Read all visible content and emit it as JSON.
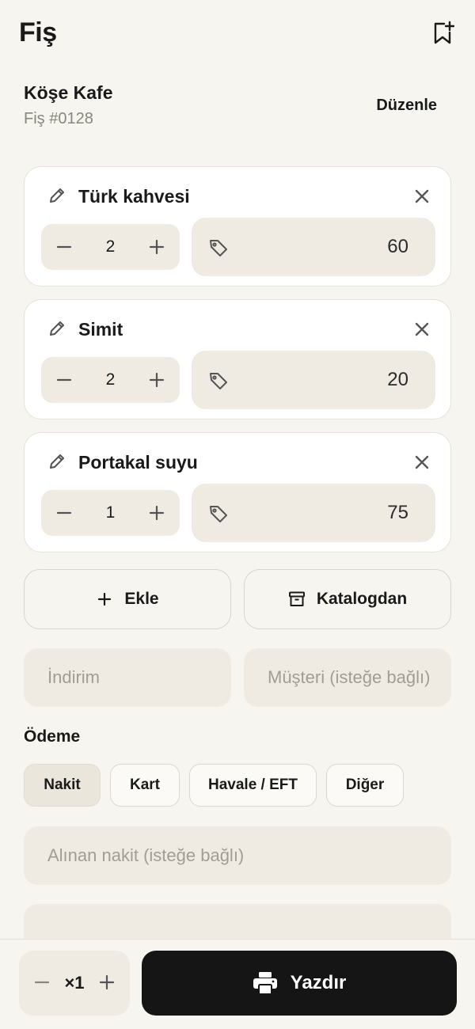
{
  "header": {
    "title": "Fiş",
    "bookmark_icon": "bookmark-add-icon"
  },
  "store": {
    "name": "Köşe Kafe",
    "receipt_number": "Fiş #0128",
    "edit_label": "Düzenle"
  },
  "items": [
    {
      "name": "Türk kahvesi",
      "quantity": "2",
      "price": "60"
    },
    {
      "name": "Simit",
      "quantity": "2",
      "price": "20"
    },
    {
      "name": "Portakal suyu",
      "quantity": "1",
      "price": "75"
    }
  ],
  "actions": {
    "add_label": "Ekle",
    "catalog_label": "Katalogdan"
  },
  "fields": {
    "discount_placeholder": "İndirim",
    "customer_placeholder": "Müşteri (isteğe bağlı)",
    "cash_placeholder": "Alınan nakit (isteğe bağlı)",
    "note_placeholder": ""
  },
  "payment": {
    "label": "Ödeme",
    "methods": [
      "Nakit",
      "Kart",
      "Havale / EFT",
      "Diğer"
    ],
    "selected": "Nakit"
  },
  "footer": {
    "copies": "×1",
    "print_label": "Yazdır"
  },
  "colors": {
    "background": "#f7f5f0",
    "surface": "#efebe3",
    "primary": "#151515"
  }
}
